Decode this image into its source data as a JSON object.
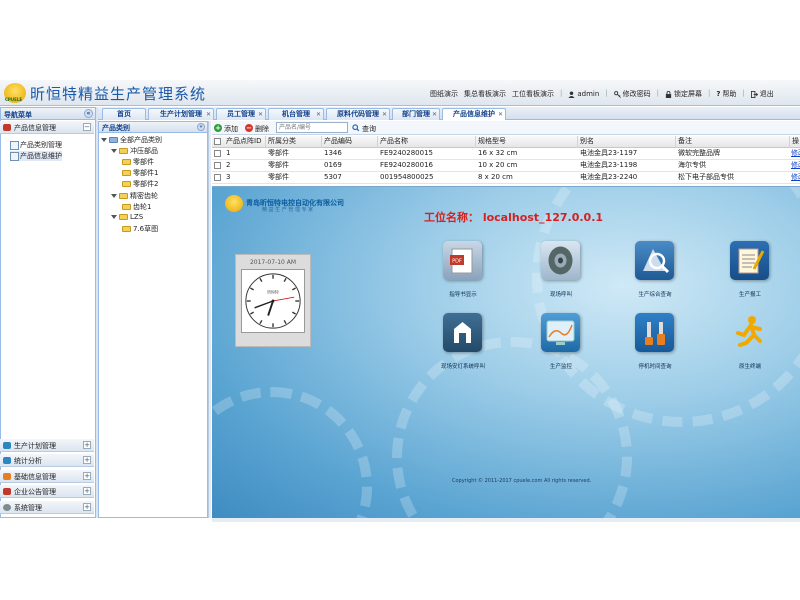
{
  "header": {
    "logo_text": "CPUELE",
    "app_title": "昕恒特精益生产管理系统",
    "links": [
      {
        "label": "图纸演示"
      },
      {
        "label": "集总看板演示"
      },
      {
        "label": "工位看板演示"
      },
      {
        "label": "admin",
        "icon": "user-icon"
      },
      {
        "label": "修改密码",
        "icon": "key-icon"
      },
      {
        "label": "锁定屏幕",
        "icon": "lock-icon"
      },
      {
        "label": "帮助",
        "icon": "help-icon"
      },
      {
        "label": "退出",
        "icon": "logout-icon"
      }
    ]
  },
  "nav": {
    "title": "导航菜单",
    "collapse_glyph": "«",
    "groups": [
      {
        "label": "产品信息管理",
        "expanded": true,
        "icon_color": "#c0392b"
      },
      {
        "label": "生产计划管理",
        "icon_color": "#2e86c1"
      },
      {
        "label": "统计分析",
        "icon_color": "#2e86c1"
      },
      {
        "label": "基础信息管理",
        "icon_color": "#e67e22"
      },
      {
        "label": "企业公告管理",
        "icon_color": "#c0392b"
      },
      {
        "label": "系统管理",
        "icon_color": "#7f8c8d"
      }
    ],
    "items": [
      {
        "label": "产品类别管理"
      },
      {
        "label": "产品信息维护"
      }
    ]
  },
  "tabs": [
    {
      "label": "首页"
    },
    {
      "label": "生产计划管理"
    },
    {
      "label": "员工管理"
    },
    {
      "label": "机台管理"
    },
    {
      "label": "原料代码管理"
    },
    {
      "label": "部门管理"
    },
    {
      "label": "产品信息维护"
    }
  ],
  "category": {
    "title": "产品类别",
    "collapse_glyph": "«",
    "tree": [
      {
        "label": "全部产品类别"
      },
      {
        "label": "冲压部品"
      },
      {
        "label": "零部件"
      },
      {
        "label": "零部件1"
      },
      {
        "label": "零部件2"
      },
      {
        "label": "精密齿轮"
      },
      {
        "label": "齿轮1"
      },
      {
        "label": "LZS"
      },
      {
        "label": "7.6草图"
      }
    ]
  },
  "toolbar": {
    "add_label": "添加",
    "delete_label": "删除",
    "search_placeholder": "产品名/编号",
    "query_label": "查询"
  },
  "table": {
    "columns": [
      "产品点阵ID",
      "所属分类",
      "产品编码",
      "产品名称",
      "规格型号",
      "别名",
      "备注",
      "操"
    ],
    "rows": [
      [
        "1",
        "零部件",
        "1346",
        "FE9240280015",
        "16 x 32 cm",
        "电池金具23-1197",
        "微软完整品牌",
        "修改"
      ],
      [
        "2",
        "零部件",
        "0169",
        "FE9240280016",
        "10 x 20 cm",
        "电池金具23-1198",
        "海尔专供",
        "修改"
      ],
      [
        "3",
        "零部件",
        "5307",
        "001954800025",
        "8 x 20 cm",
        "电池金具23-2240",
        "松下电子部品专供",
        "修改"
      ]
    ]
  },
  "desktop": {
    "company": "青岛昕恒特电控自动化有限公司",
    "company_sub": "精 益 生 产 管 理 专 家",
    "work_title": "工位名称：  localhost_127.0.0.1",
    "clock_date": "2017-07-10 AM",
    "clock_brand": "昕恒特",
    "icons": [
      {
        "label": "指导书显示",
        "icon": "pdf-document-icon"
      },
      {
        "label": "现场呼叫",
        "icon": "speaker-icon"
      },
      {
        "label": "生产综合查询",
        "icon": "magnifier-icon"
      },
      {
        "label": "生产报工",
        "icon": "notepad-icon"
      },
      {
        "label": "现场安灯系统呼叫",
        "icon": "andon-icon"
      },
      {
        "label": "生产监控",
        "icon": "monitor-chart-icon"
      },
      {
        "label": "停机时间查询",
        "icon": "tools-icon"
      },
      {
        "label": "原生终端",
        "icon": "running-person-icon"
      }
    ],
    "copyright": "Copyright © 2011-2017 cpuele.com All rights reserved."
  }
}
